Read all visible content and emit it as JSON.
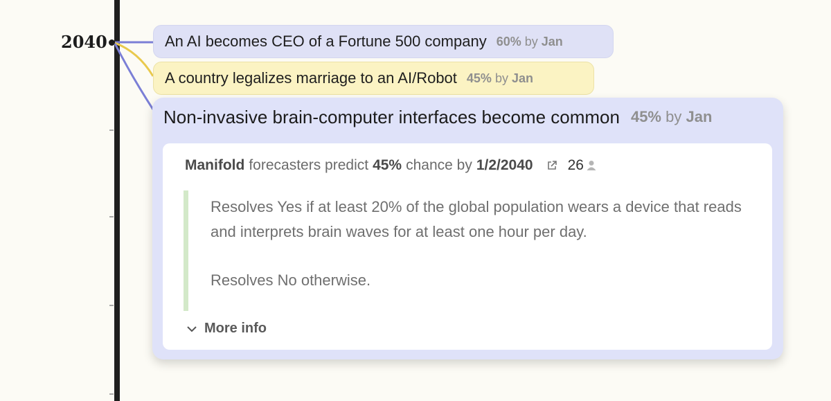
{
  "timeline": {
    "year": "2040"
  },
  "events": [
    {
      "title": "An AI becomes CEO of a Fortune 500 company",
      "probability": "60%",
      "by": "by",
      "author": "Jan",
      "color": "#7b7fd6"
    },
    {
      "title": "A country legalizes marriage to an AI/Robot",
      "probability": "45%",
      "by": "by",
      "author": "Jan",
      "color": "#e9c94d"
    }
  ],
  "expanded": {
    "title": "Non-invasive brain-computer interfaces become common",
    "probability": "45%",
    "by": "by",
    "author": "Jan",
    "color": "#7b7fd6",
    "forecast": {
      "source": "Manifold",
      "predict_text": "forecasters predict",
      "probability": "45%",
      "chance_text": "chance by",
      "date": "1/2/2040",
      "forecaster_count": "26",
      "icons": [
        "external-link-icon",
        "user-icon"
      ]
    },
    "description": [
      "Resolves Yes if at least 20% of the global population wears a device that reads and interprets brain waves for at least one hour per day.",
      "Resolves No otherwise."
    ],
    "more_info_label": "More info",
    "more_info_icon": "chevron-down-icon"
  }
}
